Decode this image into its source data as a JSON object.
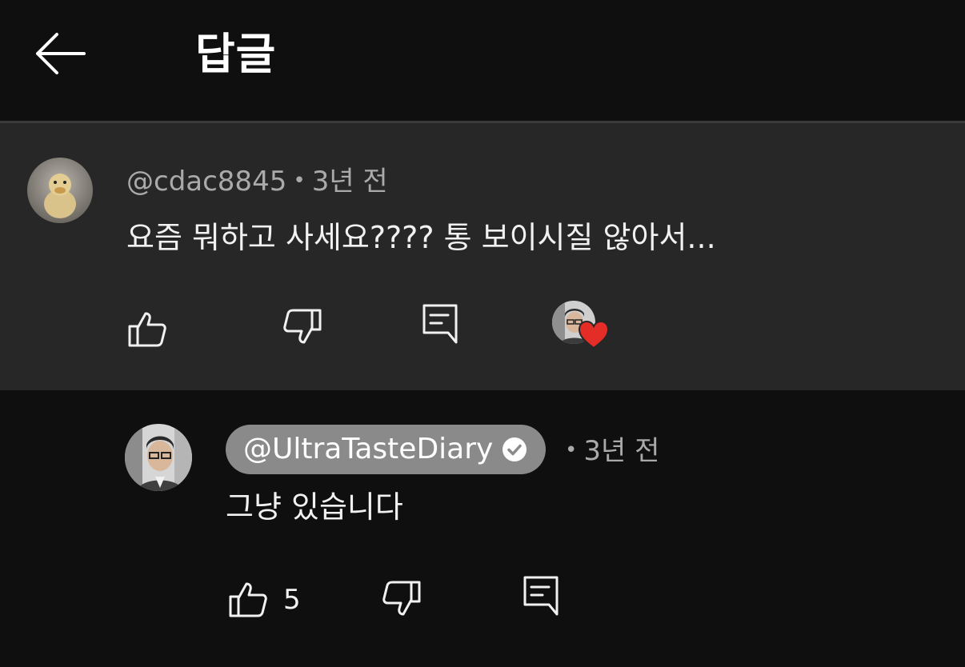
{
  "header": {
    "title": "답글",
    "back_icon": "arrow-left-icon"
  },
  "parent_comment": {
    "author": "@cdac8845",
    "time": "3년 전",
    "separator": "•",
    "text": "요즘 뭐하고 사세요???? 통 보이시질 않아서...",
    "actions": {
      "like_icon": "thumbs-up-icon",
      "dislike_icon": "thumbs-down-icon",
      "reply_icon": "comment-icon",
      "creator_heart_icon": "heart-icon"
    }
  },
  "reply": {
    "author": "@UltraTasteDiary",
    "verified_icon": "verified-check-icon",
    "separator": "•",
    "time": "3년 전",
    "text": "그냥 있습니다",
    "like_count": "5",
    "actions": {
      "like_icon": "thumbs-up-icon",
      "dislike_icon": "thumbs-down-icon",
      "reply_icon": "comment-icon"
    }
  },
  "colors": {
    "background": "#0f0f0f",
    "parent_background": "#272727",
    "heart": "#e52d27",
    "author_chip": "#8a8a8a",
    "meta_text": "#aaaaaa"
  }
}
